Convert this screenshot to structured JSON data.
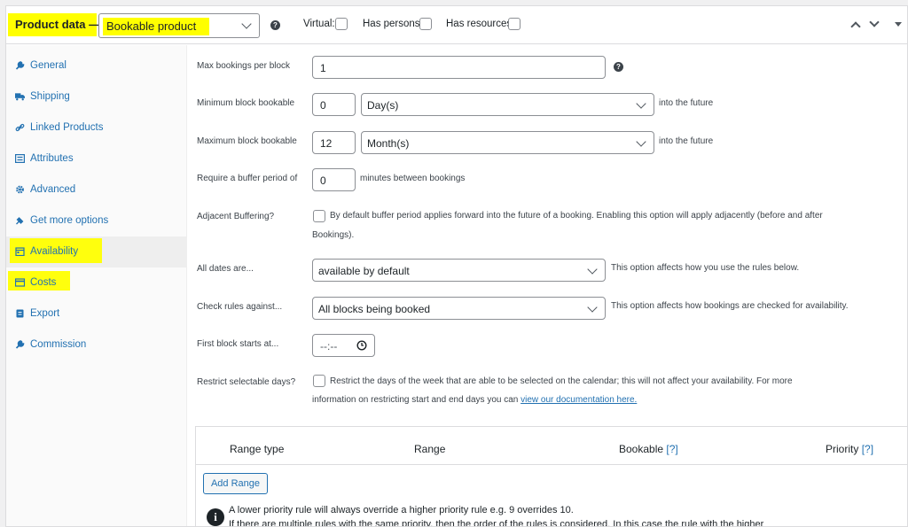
{
  "header": {
    "label": "Product data —",
    "product_type": "Bookable product",
    "virtual_label": "Virtual:",
    "has_persons_label": "Has persons:",
    "has_resources_label": "Has resources:"
  },
  "sidebar": {
    "items": [
      {
        "label": "General",
        "icon": "wrench-icon"
      },
      {
        "label": "Shipping",
        "icon": "truck-icon"
      },
      {
        "label": "Linked Products",
        "icon": "link-icon"
      },
      {
        "label": "Attributes",
        "icon": "list-icon"
      },
      {
        "label": "Advanced",
        "icon": "gear-icon"
      },
      {
        "label": "Get more options",
        "icon": "plugin-icon"
      },
      {
        "label": "Availability",
        "icon": "calendar-icon"
      },
      {
        "label": "Costs",
        "icon": "card-icon"
      },
      {
        "label": "Export",
        "icon": "export-icon"
      },
      {
        "label": "Commission",
        "icon": "wrench-icon"
      }
    ]
  },
  "fields": {
    "max_bookings": {
      "label": "Max bookings per block",
      "value": "1"
    },
    "min_block": {
      "label": "Minimum block bookable",
      "value": "0",
      "unit": "Day(s)",
      "suffix": "into the future"
    },
    "max_block": {
      "label": "Maximum block bookable",
      "value": "12",
      "unit": "Month(s)",
      "suffix": "into the future"
    },
    "buffer": {
      "label": "Require a buffer period of",
      "value": "0",
      "suffix": "minutes between bookings"
    },
    "adjacent": {
      "label": "Adjacent Buffering?",
      "description_line1": "By default buffer period applies forward into the future of a booking. Enabling this option will apply adjacently (before and after",
      "description_line2": "Bookings)."
    },
    "all_dates": {
      "label": "All dates are...",
      "value": "available by default",
      "help": "This option affects how you use the rules below."
    },
    "check_rules": {
      "label": "Check rules against...",
      "value": "All blocks being booked",
      "help": "This option affects how bookings are checked for availability."
    },
    "first_block": {
      "label": "First block starts at...",
      "value": "--:--"
    },
    "restrict_days": {
      "label": "Restrict selectable days?",
      "description_line1": "Restrict the days of the week that are able to be selected on the calendar; this will not affect your availability. For more",
      "description_line2_prefix": "information on restricting start and end days you can ",
      "link_text": "view our documentation here."
    }
  },
  "table": {
    "columns": [
      "Range type",
      "Range",
      "Bookable",
      "Priority"
    ],
    "help_marker": "[?]",
    "add_button": "Add Range",
    "note_line1": "A lower priority rule will always override a higher priority rule e.g. 9 overrides 10.",
    "note_line2": "If there are multiple rules with the same priority, then the order of the rules is considered. In this case the rule with the higher"
  },
  "colors": {
    "highlight": "#ffff00",
    "link": "#2271b1"
  }
}
